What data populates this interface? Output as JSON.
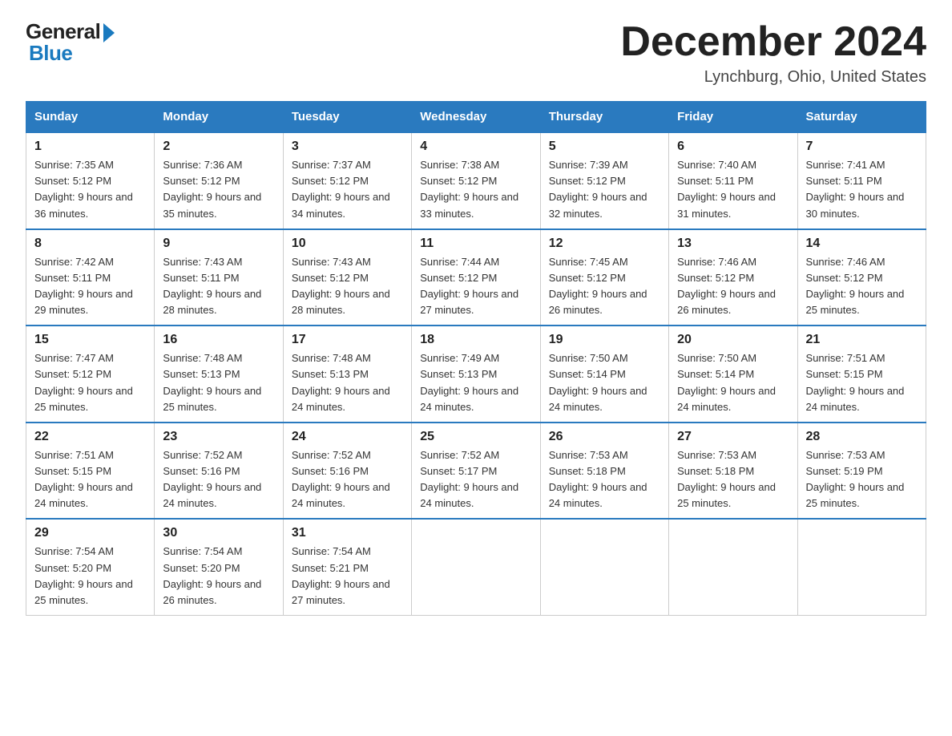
{
  "logo": {
    "general": "General",
    "blue": "Blue",
    "subtitle": ""
  },
  "header": {
    "month": "December 2024",
    "location": "Lynchburg, Ohio, United States"
  },
  "weekdays": [
    "Sunday",
    "Monday",
    "Tuesday",
    "Wednesday",
    "Thursday",
    "Friday",
    "Saturday"
  ],
  "weeks": [
    [
      {
        "day": "1",
        "sunrise": "7:35 AM",
        "sunset": "5:12 PM",
        "daylight": "9 hours and 36 minutes."
      },
      {
        "day": "2",
        "sunrise": "7:36 AM",
        "sunset": "5:12 PM",
        "daylight": "9 hours and 35 minutes."
      },
      {
        "day": "3",
        "sunrise": "7:37 AM",
        "sunset": "5:12 PM",
        "daylight": "9 hours and 34 minutes."
      },
      {
        "day": "4",
        "sunrise": "7:38 AM",
        "sunset": "5:12 PM",
        "daylight": "9 hours and 33 minutes."
      },
      {
        "day": "5",
        "sunrise": "7:39 AM",
        "sunset": "5:12 PM",
        "daylight": "9 hours and 32 minutes."
      },
      {
        "day": "6",
        "sunrise": "7:40 AM",
        "sunset": "5:11 PM",
        "daylight": "9 hours and 31 minutes."
      },
      {
        "day": "7",
        "sunrise": "7:41 AM",
        "sunset": "5:11 PM",
        "daylight": "9 hours and 30 minutes."
      }
    ],
    [
      {
        "day": "8",
        "sunrise": "7:42 AM",
        "sunset": "5:11 PM",
        "daylight": "9 hours and 29 minutes."
      },
      {
        "day": "9",
        "sunrise": "7:43 AM",
        "sunset": "5:11 PM",
        "daylight": "9 hours and 28 minutes."
      },
      {
        "day": "10",
        "sunrise": "7:43 AM",
        "sunset": "5:12 PM",
        "daylight": "9 hours and 28 minutes."
      },
      {
        "day": "11",
        "sunrise": "7:44 AM",
        "sunset": "5:12 PM",
        "daylight": "9 hours and 27 minutes."
      },
      {
        "day": "12",
        "sunrise": "7:45 AM",
        "sunset": "5:12 PM",
        "daylight": "9 hours and 26 minutes."
      },
      {
        "day": "13",
        "sunrise": "7:46 AM",
        "sunset": "5:12 PM",
        "daylight": "9 hours and 26 minutes."
      },
      {
        "day": "14",
        "sunrise": "7:46 AM",
        "sunset": "5:12 PM",
        "daylight": "9 hours and 25 minutes."
      }
    ],
    [
      {
        "day": "15",
        "sunrise": "7:47 AM",
        "sunset": "5:12 PM",
        "daylight": "9 hours and 25 minutes."
      },
      {
        "day": "16",
        "sunrise": "7:48 AM",
        "sunset": "5:13 PM",
        "daylight": "9 hours and 25 minutes."
      },
      {
        "day": "17",
        "sunrise": "7:48 AM",
        "sunset": "5:13 PM",
        "daylight": "9 hours and 24 minutes."
      },
      {
        "day": "18",
        "sunrise": "7:49 AM",
        "sunset": "5:13 PM",
        "daylight": "9 hours and 24 minutes."
      },
      {
        "day": "19",
        "sunrise": "7:50 AM",
        "sunset": "5:14 PM",
        "daylight": "9 hours and 24 minutes."
      },
      {
        "day": "20",
        "sunrise": "7:50 AM",
        "sunset": "5:14 PM",
        "daylight": "9 hours and 24 minutes."
      },
      {
        "day": "21",
        "sunrise": "7:51 AM",
        "sunset": "5:15 PM",
        "daylight": "9 hours and 24 minutes."
      }
    ],
    [
      {
        "day": "22",
        "sunrise": "7:51 AM",
        "sunset": "5:15 PM",
        "daylight": "9 hours and 24 minutes."
      },
      {
        "day": "23",
        "sunrise": "7:52 AM",
        "sunset": "5:16 PM",
        "daylight": "9 hours and 24 minutes."
      },
      {
        "day": "24",
        "sunrise": "7:52 AM",
        "sunset": "5:16 PM",
        "daylight": "9 hours and 24 minutes."
      },
      {
        "day": "25",
        "sunrise": "7:52 AM",
        "sunset": "5:17 PM",
        "daylight": "9 hours and 24 minutes."
      },
      {
        "day": "26",
        "sunrise": "7:53 AM",
        "sunset": "5:18 PM",
        "daylight": "9 hours and 24 minutes."
      },
      {
        "day": "27",
        "sunrise": "7:53 AM",
        "sunset": "5:18 PM",
        "daylight": "9 hours and 25 minutes."
      },
      {
        "day": "28",
        "sunrise": "7:53 AM",
        "sunset": "5:19 PM",
        "daylight": "9 hours and 25 minutes."
      }
    ],
    [
      {
        "day": "29",
        "sunrise": "7:54 AM",
        "sunset": "5:20 PM",
        "daylight": "9 hours and 25 minutes."
      },
      {
        "day": "30",
        "sunrise": "7:54 AM",
        "sunset": "5:20 PM",
        "daylight": "9 hours and 26 minutes."
      },
      {
        "day": "31",
        "sunrise": "7:54 AM",
        "sunset": "5:21 PM",
        "daylight": "9 hours and 27 minutes."
      },
      null,
      null,
      null,
      null
    ]
  ]
}
